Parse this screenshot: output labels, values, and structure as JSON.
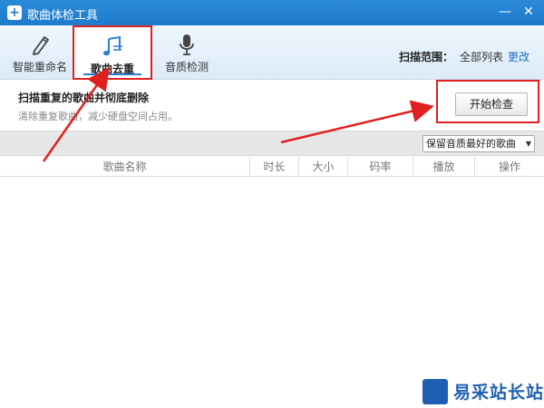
{
  "window": {
    "title": "歌曲体检工具"
  },
  "tabs": [
    {
      "label": "智能重命名",
      "icon": "pencil-icon"
    },
    {
      "label": "歌曲去重",
      "icon": "music-note-icon",
      "active": true
    },
    {
      "label": "音质检测",
      "icon": "microphone-icon"
    }
  ],
  "scope": {
    "label": "扫描范围：",
    "value": "全部列表",
    "change_link": "更改"
  },
  "info": {
    "heading": "扫描重复的歌曲并彻底删除",
    "subtext": "清除重复歌曲，减少硬盘空间占用。"
  },
  "start_button": "开始检查",
  "filter": {
    "selected": "保留音质最好的歌曲"
  },
  "table": {
    "columns": [
      "歌曲名称",
      "时长",
      "大小",
      "码率",
      "播放",
      "操作"
    ],
    "rows": []
  },
  "watermark": {
    "text": "易采站长站"
  },
  "colors": {
    "titlebar": "#1f7bcc",
    "highlight": "#e02020",
    "link": "#1a6fd0"
  }
}
